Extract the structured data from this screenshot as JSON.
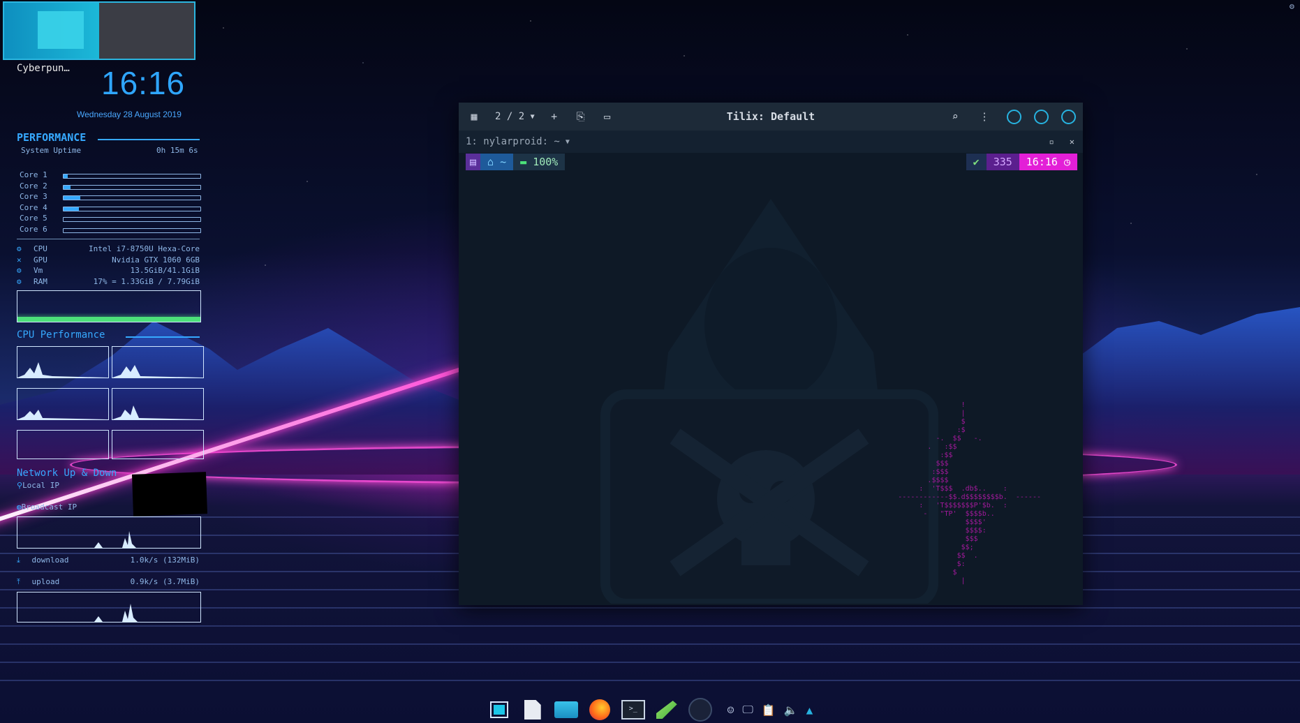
{
  "desktop": {
    "workspace_label": "Cyberpun…"
  },
  "conky": {
    "clock": "16:16",
    "date": "Wednesday 28 August 2019",
    "performance_title": "PERFORMANCE",
    "uptime_label": "System Uptime",
    "uptime_value": "0h 15m 6s",
    "cores": [
      {
        "label": "Core 1",
        "percent": 3
      },
      {
        "label": "Core 2",
        "percent": 5
      },
      {
        "label": "Core 3",
        "percent": 12
      },
      {
        "label": "Core 4",
        "percent": 11
      },
      {
        "label": "Core 5",
        "percent": 0
      },
      {
        "label": "Core 6",
        "percent": 0
      }
    ],
    "system": [
      {
        "key": "CPU",
        "value": "Intel i7-8750U Hexa-Core",
        "icon": "gears-icon"
      },
      {
        "key": "GPU",
        "value": "Nvidia GTX 1060 6GB",
        "icon": "gpu-icon"
      },
      {
        "key": "Vm",
        "value": "13.5GiB/41.1GiB",
        "icon": "gears-icon"
      },
      {
        "key": "RAM",
        "value": "17% = 1.33GiB / 7.79GiB",
        "icon": "gears-icon"
      }
    ],
    "cpu_section_title": "CPU Performance",
    "network_title": "Network Up & Down",
    "local_ip_label": "Local IP",
    "broadcast_ip_label": "Broadcast IP",
    "download_label": "download",
    "download_value": "1.0k/s (132MiB)",
    "upload_label": "upload",
    "upload_value": "0.9k/s (3.7MiB)",
    "accent_color": "#36a9ff"
  },
  "tilix": {
    "session_counter": "2 / 2",
    "title": "Tilix: Default",
    "terminal_tab": "1: nylarproid: ~",
    "prompt": {
      "home": "~",
      "battery": "100%",
      "history_number": "335",
      "time": "16:16"
    },
    "ascii_art": "                 !\n                 |\n                 $\n                :$\n           -.  $$   -.\n         .   :$$\n            :$$\n           $$$\n          :$$$\n         .$$$$\n       :  'T$$$  .db$..    :\n  ------------$$.d$$$$$$$$b.  ------\n       :   'T$$$$$$$P'$b.  :\n        -   \"TP'  $$$$b..\n                  $$$$'\n                  $$$$:\n                  $$$\n                 $$;\n                $$  .\n                $:\n               $\n                 |"
  },
  "taskbar": {
    "apps": [
      "workspace-icon",
      "files-icon",
      "folder-icon",
      "firefox-icon",
      "terminal-icon",
      "editor-icon",
      "monitor-icon"
    ],
    "tray": [
      "chat-icon",
      "display-icon",
      "clipboard-icon",
      "volume-icon",
      "tray-up-icon"
    ]
  }
}
